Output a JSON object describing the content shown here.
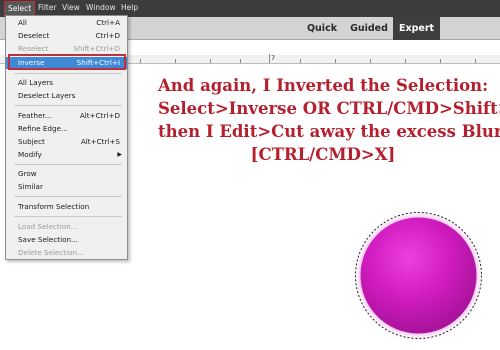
{
  "menubar": {
    "items": [
      "Select",
      "Filter",
      "View",
      "Window",
      "Help"
    ]
  },
  "modes": {
    "tabs": [
      "Quick",
      "Guided",
      "Expert"
    ],
    "active": "Expert"
  },
  "ruler": {
    "label": "7"
  },
  "select_menu": {
    "items": [
      {
        "label": "All",
        "shortcut": "Ctrl+A",
        "enabled": true
      },
      {
        "label": "Deselect",
        "shortcut": "Ctrl+D",
        "enabled": true
      },
      {
        "label": "Reselect",
        "shortcut": "Shift+Ctrl+D",
        "enabled": false
      },
      {
        "label": "Inverse",
        "shortcut": "Shift+Ctrl+I",
        "enabled": true,
        "highlighted": true
      },
      {
        "label": "All Layers",
        "shortcut": "",
        "enabled": true
      },
      {
        "label": "Deselect Layers",
        "shortcut": "",
        "enabled": true
      },
      {
        "label": "Feather...",
        "shortcut": "Alt+Ctrl+D",
        "enabled": true
      },
      {
        "label": "Refine Edge...",
        "shortcut": "",
        "enabled": true
      },
      {
        "label": "Subject",
        "shortcut": "Alt+Ctrl+S",
        "enabled": true
      },
      {
        "label": "Modify",
        "shortcut": "",
        "enabled": true,
        "submenu": true
      },
      {
        "label": "Grow",
        "shortcut": "",
        "enabled": true
      },
      {
        "label": "Similar",
        "shortcut": "",
        "enabled": true
      },
      {
        "label": "Transform Selection",
        "shortcut": "",
        "enabled": true
      },
      {
        "label": "Load Selection...",
        "shortcut": "",
        "enabled": false
      },
      {
        "label": "Save Selection...",
        "shortcut": "",
        "enabled": true
      },
      {
        "label": "Delete Selection...",
        "shortcut": "",
        "enabled": false
      }
    ]
  },
  "instruction": {
    "lines": [
      "And again, I Inverted the Selection:",
      "Select>Inverse OR CTRL/CMD>Shift>I",
      "then I Edit>Cut away the excess Blur",
      "[CTRL/CMD>X]"
    ]
  },
  "colors": {
    "menubar_bg": "#3c3c3c",
    "highlight": "#3f88d6",
    "annotation_red": "#c0303a",
    "instruction_text": "#b5202f",
    "sphere_magenta": "#d21bc0"
  },
  "icons": {
    "submenu": "submenu-arrow-icon"
  }
}
